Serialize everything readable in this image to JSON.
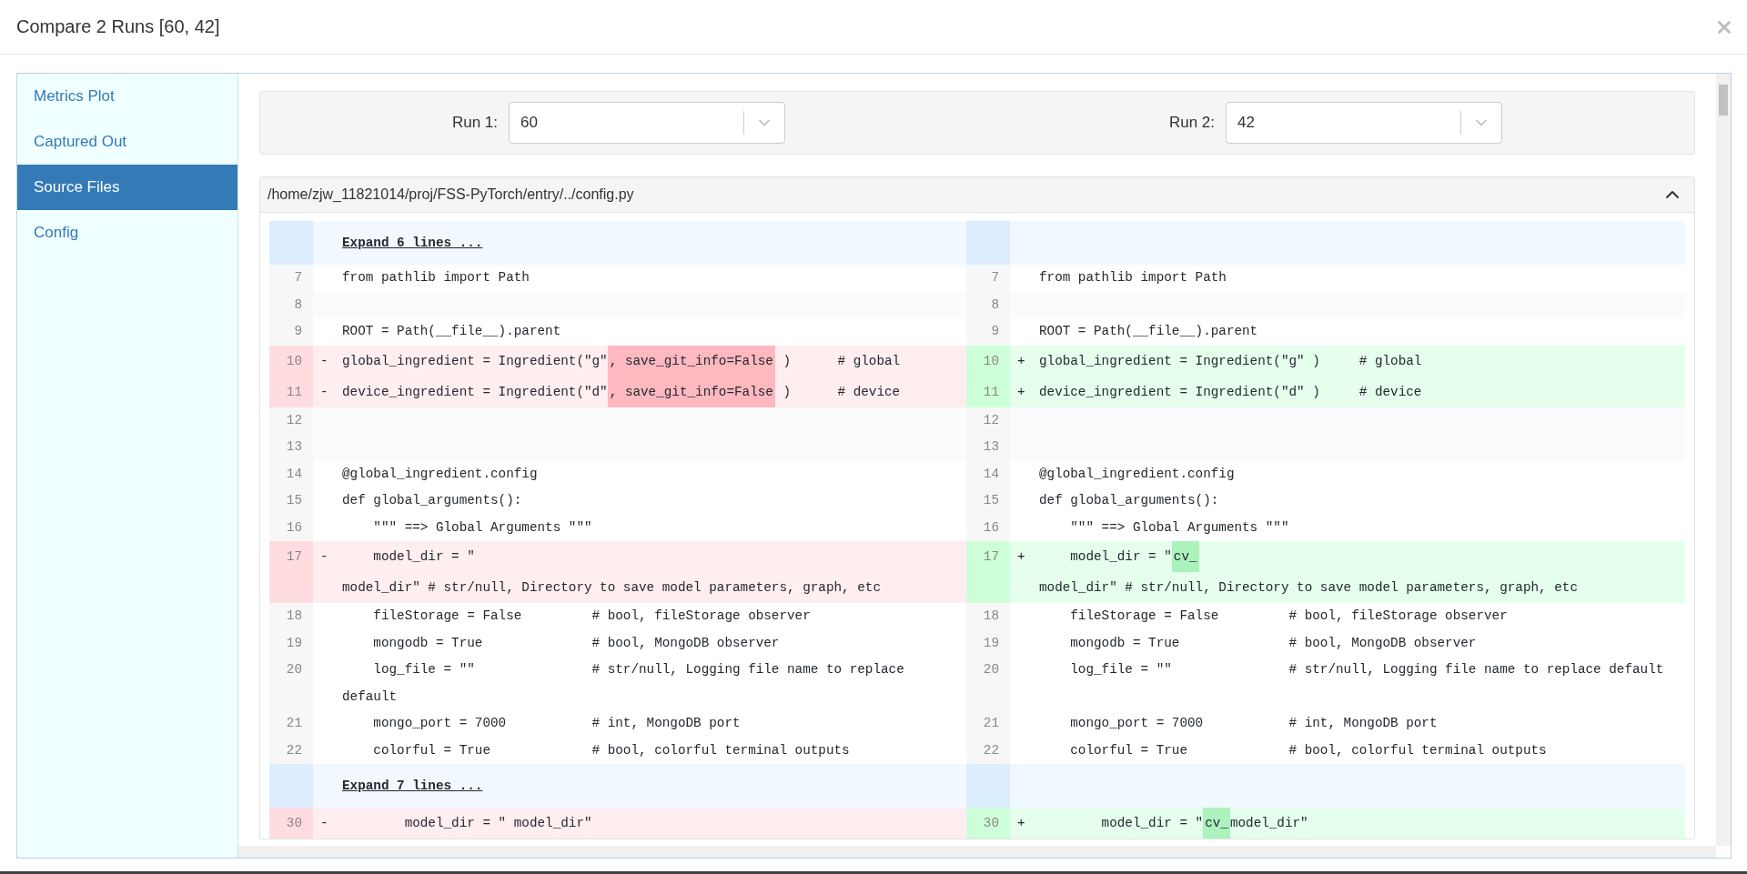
{
  "dialog": {
    "title": "Compare 2 Runs [60, 42]"
  },
  "sidebar": {
    "items": [
      {
        "label": "Metrics Plot",
        "selected": false
      },
      {
        "label": "Captured Out",
        "selected": false
      },
      {
        "label": "Source Files",
        "selected": true
      },
      {
        "label": "Config",
        "selected": false
      }
    ]
  },
  "run_selectors": [
    {
      "label": "Run 1:",
      "value": "60"
    },
    {
      "label": "Run 2:",
      "value": "42"
    }
  ],
  "file": {
    "path": "/home/zjw_11821014/proj/FSS-PyTorch/entry/../config.py",
    "expanded": true,
    "rows": [
      {
        "kind": "expand",
        "label": "Expand 6 lines ..."
      },
      {
        "kind": "lines",
        "left": {
          "number": "7",
          "changed": false,
          "lines": [
            [
              {
                "text": "from pathlib import Path",
                "changed": false
              }
            ]
          ]
        },
        "right": {
          "number": "7",
          "changed": false,
          "lines": [
            [
              {
                "text": "from pathlib import Path",
                "changed": false
              }
            ]
          ]
        }
      },
      {
        "kind": "lines",
        "left": {
          "number": "8",
          "changed": false
        },
        "right": {
          "number": "8",
          "changed": false
        }
      },
      {
        "kind": "lines",
        "left": {
          "number": "9",
          "changed": false,
          "lines": [
            [
              {
                "text": "ROOT = Path(__file__).parent",
                "changed": false
              }
            ]
          ]
        },
        "right": {
          "number": "9",
          "changed": false,
          "lines": [
            [
              {
                "text": "ROOT = Path(__file__).parent",
                "changed": false
              }
            ]
          ]
        }
      },
      {
        "kind": "lines",
        "left": {
          "number": "10",
          "changed": true,
          "sign": "-",
          "lines": [
            [
              {
                "text": "global_ingredient = Ingredient(\"g\"",
                "changed": false
              },
              {
                "text": ", save_git_info=False",
                "changed": true
              },
              {
                "text": " )      # global",
                "changed": false
              }
            ]
          ]
        },
        "right": {
          "number": "10",
          "changed": true,
          "sign": "+",
          "lines": [
            [
              {
                "text": "global_ingredient = Ingredient(\"g\" )     # global",
                "changed": false
              }
            ]
          ]
        }
      },
      {
        "kind": "lines",
        "left": {
          "number": "11",
          "changed": true,
          "sign": "-",
          "lines": [
            [
              {
                "text": "device_ingredient = Ingredient(\"d\"",
                "changed": false
              },
              {
                "text": ", save_git_info=False",
                "changed": true
              },
              {
                "text": " )      # device",
                "changed": false
              }
            ]
          ]
        },
        "right": {
          "number": "11",
          "changed": true,
          "sign": "+",
          "lines": [
            [
              {
                "text": "device_ingredient = Ingredient(\"d\" )     # device",
                "changed": false
              }
            ]
          ]
        }
      },
      {
        "kind": "lines",
        "left": {
          "number": "12",
          "changed": false
        },
        "right": {
          "number": "12",
          "changed": false
        }
      },
      {
        "kind": "lines",
        "left": {
          "number": "13",
          "changed": false
        },
        "right": {
          "number": "13",
          "changed": false
        }
      },
      {
        "kind": "lines",
        "left": {
          "number": "14",
          "changed": false,
          "lines": [
            [
              {
                "text": "@global_ingredient.config",
                "changed": false
              }
            ]
          ]
        },
        "right": {
          "number": "14",
          "changed": false,
          "lines": [
            [
              {
                "text": "@global_ingredient.config",
                "changed": false
              }
            ]
          ]
        }
      },
      {
        "kind": "lines",
        "left": {
          "number": "15",
          "changed": false,
          "lines": [
            [
              {
                "text": "def global_arguments():",
                "changed": false
              }
            ]
          ]
        },
        "right": {
          "number": "15",
          "changed": false,
          "lines": [
            [
              {
                "text": "def global_arguments():",
                "changed": false
              }
            ]
          ]
        }
      },
      {
        "kind": "lines",
        "left": {
          "number": "16",
          "changed": false,
          "lines": [
            [
              {
                "text": "    \"\"\" ==> Global Arguments \"\"\"",
                "changed": false
              }
            ]
          ]
        },
        "right": {
          "number": "16",
          "changed": false,
          "lines": [
            [
              {
                "text": "    \"\"\" ==> Global Arguments \"\"\"",
                "changed": false
              }
            ]
          ]
        }
      },
      {
        "kind": "lines",
        "left": {
          "number": "17",
          "changed": true,
          "sign": "-",
          "lines": [
            [
              {
                "text": "    model_dir = \"",
                "changed": false
              }
            ],
            [
              {
                "text": "model_dir\" # str/null, Directory to save model parameters, graph, etc",
                "changed": false
              }
            ]
          ]
        },
        "right": {
          "number": "17",
          "changed": true,
          "sign": "+",
          "lines": [
            [
              {
                "text": "    model_dir = \"",
                "changed": false
              },
              {
                "text": "cv_",
                "changed": true
              }
            ],
            [
              {
                "text": "model_dir\" # str/null, Directory to save model parameters, graph, etc",
                "changed": false
              }
            ]
          ]
        }
      },
      {
        "kind": "lines",
        "left": {
          "number": "18",
          "changed": false,
          "lines": [
            [
              {
                "text": "    fileStorage = False         # bool, fileStorage observer",
                "changed": false
              }
            ]
          ]
        },
        "right": {
          "number": "18",
          "changed": false,
          "lines": [
            [
              {
                "text": "    fileStorage = False         # bool, fileStorage observer",
                "changed": false
              }
            ]
          ]
        }
      },
      {
        "kind": "lines",
        "left": {
          "number": "19",
          "changed": false,
          "lines": [
            [
              {
                "text": "    mongodb = True              # bool, MongoDB observer",
                "changed": false
              }
            ]
          ]
        },
        "right": {
          "number": "19",
          "changed": false,
          "lines": [
            [
              {
                "text": "    mongodb = True              # bool, MongoDB observer",
                "changed": false
              }
            ]
          ]
        }
      },
      {
        "kind": "lines",
        "left": {
          "number": "20",
          "changed": false,
          "lines": [
            [
              {
                "text": "    log_file = \"\"               # str/null, Logging file name to replace",
                "changed": false
              }
            ],
            [
              {
                "text": "default",
                "changed": false
              }
            ]
          ]
        },
        "right": {
          "number": "20",
          "changed": false,
          "lines": [
            [
              {
                "text": "    log_file = \"\"               # str/null, Logging file name to replace default",
                "changed": false
              }
            ]
          ]
        }
      },
      {
        "kind": "lines",
        "left": {
          "number": "21",
          "changed": false,
          "lines": [
            [
              {
                "text": "    mongo_port = 7000           # int, MongoDB port",
                "changed": false
              }
            ]
          ]
        },
        "right": {
          "number": "21",
          "changed": false,
          "lines": [
            [
              {
                "text": "    mongo_port = 7000           # int, MongoDB port",
                "changed": false
              }
            ]
          ]
        }
      },
      {
        "kind": "lines",
        "left": {
          "number": "22",
          "changed": false,
          "lines": [
            [
              {
                "text": "    colorful = True             # bool, colorful terminal outputs",
                "changed": false
              }
            ]
          ]
        },
        "right": {
          "number": "22",
          "changed": false,
          "lines": [
            [
              {
                "text": "    colorful = True             # bool, colorful terminal outputs",
                "changed": false
              }
            ]
          ]
        }
      },
      {
        "kind": "expand",
        "label": "Expand 7 lines ..."
      },
      {
        "kind": "lines",
        "left": {
          "number": "30",
          "changed": true,
          "sign": "-",
          "lines": [
            [
              {
                "text": "        model_dir = \" model_dir\"",
                "changed": false
              }
            ]
          ]
        },
        "right": {
          "number": "30",
          "changed": true,
          "sign": "+",
          "lines": [
            [
              {
                "text": "        model_dir = \"",
                "changed": false
              },
              {
                "text": "cv_",
                "changed": true
              },
              {
                "text": "model_dir\"",
                "changed": false
              }
            ]
          ]
        }
      }
    ]
  }
}
